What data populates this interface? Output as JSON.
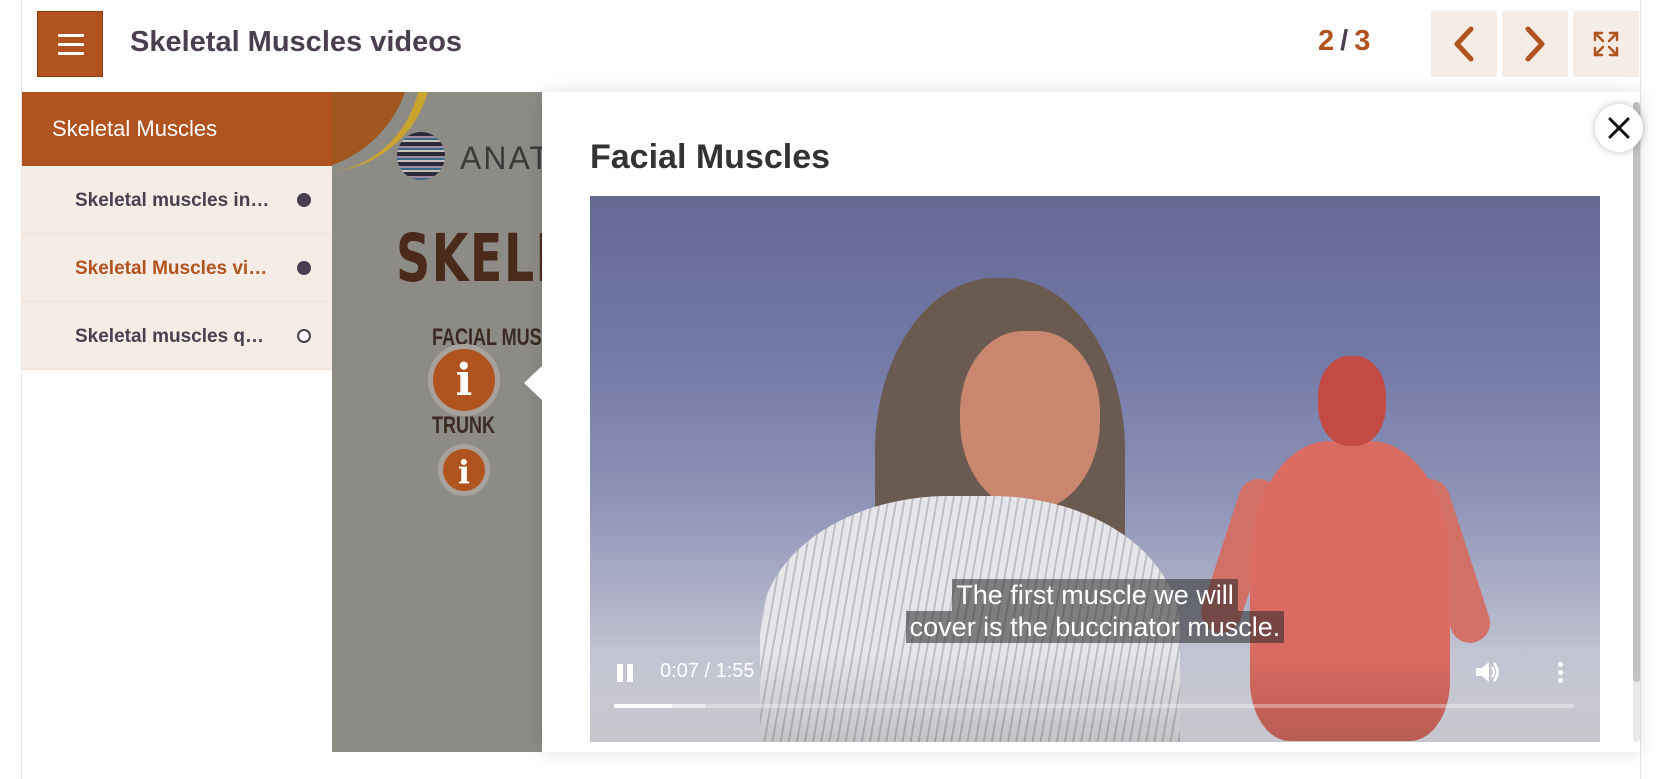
{
  "header": {
    "title": "Skeletal Muscles videos",
    "page_current": "2",
    "page_separator": "/",
    "page_total": "3",
    "menu_icon": "hamburger-icon",
    "prev_icon": "chevron-left-icon",
    "next_icon": "chevron-right-icon",
    "fullscreen_icon": "fullscreen-icon"
  },
  "sidebar": {
    "heading": "Skeletal Muscles",
    "items": [
      {
        "label": "Skeletal muscles introduction",
        "status": "visited"
      },
      {
        "label": "Skeletal Muscles videos",
        "status": "current"
      },
      {
        "label": "Skeletal muscles quiz",
        "status": "unvisited"
      }
    ]
  },
  "slide": {
    "logo_text": "ANAT",
    "heading": "SKELET",
    "label_1": "FACIAL MUS",
    "label_2": "TRUNK",
    "info_glyph": "i"
  },
  "popup": {
    "title": "Facial Muscles",
    "close_icon": "close-icon"
  },
  "video": {
    "caption_line_1": "The first muscle we will",
    "caption_line_2": "cover is the buccinator muscle.",
    "time": "0:07 / 1:55",
    "progress_fraction": 0.06,
    "buffered_fraction": 0.095,
    "play_state": "playing",
    "pause_icon": "pause-icon",
    "volume_icon": "volume-icon",
    "more_icon": "more-vertical-icon"
  },
  "colors": {
    "accent": "#b0531e",
    "text_dark": "#4a3f4f",
    "sidebar_bg": "#f6ece6"
  }
}
